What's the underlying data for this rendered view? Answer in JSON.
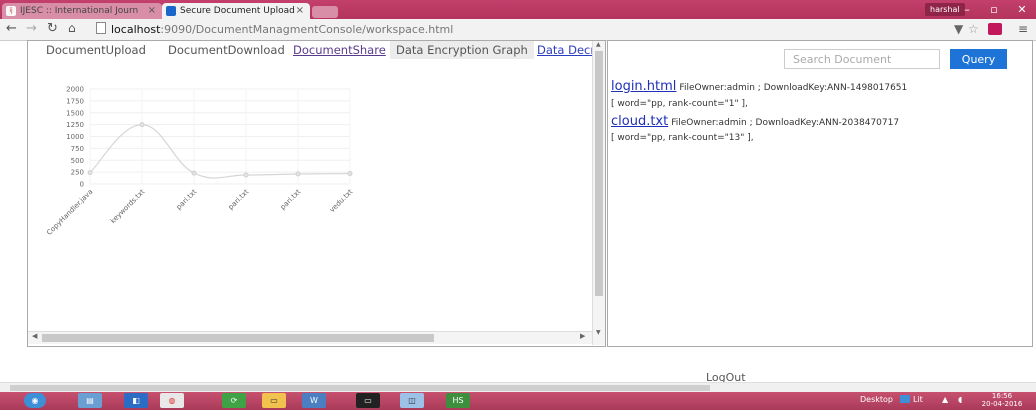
{
  "browser": {
    "tabs": [
      {
        "label": "IJESC :: International Journ",
        "favicon": "ijesc-icon"
      },
      {
        "label": "Secure Document Upload",
        "favicon": "upload-icon"
      }
    ],
    "user": "harshal",
    "url_host": "localhost",
    "url_path": ":9090/DocumentManagmentConsole/workspace.html"
  },
  "left_panel": {
    "tabs": [
      "DocumentUpload",
      "DocumentDownload",
      "DocumentShare",
      "Data Encryption Graph",
      "Data Decr"
    ],
    "active_tab": "Data Encryption Graph"
  },
  "chart_data": {
    "type": "line",
    "categories": [
      "CopyHandler.java",
      "keywords.txt",
      "pari.txt",
      "pari.txt",
      "pari.txt",
      "vedu.txt"
    ],
    "values": [
      240,
      1250,
      230,
      190,
      210,
      220
    ],
    "ylim": [
      0,
      2000
    ],
    "yticks": [
      0,
      250,
      500,
      750,
      1000,
      1250,
      1500,
      1750,
      2000
    ],
    "grid": true,
    "line_color": "#d6d6d6"
  },
  "right_panel": {
    "search_placeholder": "Search Document",
    "query_label": "Query",
    "results": [
      {
        "file": "login.html",
        "meta": "FileOwner:admin ; DownloadKey:ANN-1498017651",
        "keyword": "[ word=\"pp, rank-count=\"1\" ],"
      },
      {
        "file": "cloud.txt",
        "meta": "FileOwner:admin ; DownloadKey:ANN-2038470717",
        "keyword": "[ word=\"pp, rank-count=\"13\" ],"
      }
    ]
  },
  "footer": {
    "logout_label": "LogOut"
  },
  "taskbar": {
    "desktop_label": "Desktop",
    "lit_label": "Lit",
    "time": "16:56",
    "date": "20-04-2016"
  }
}
